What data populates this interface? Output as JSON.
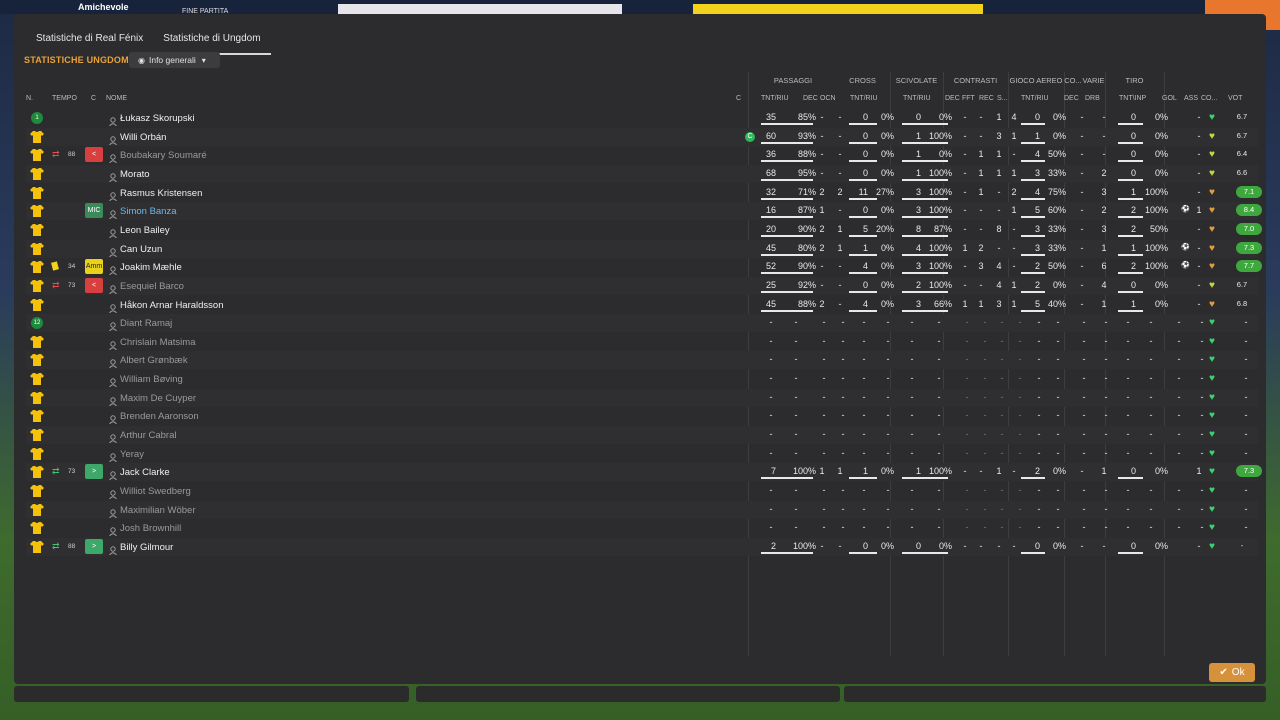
{
  "background": {
    "comp": "Amichevole",
    "status": "FINE PARTITA"
  },
  "tabs": [
    "Statistiche di Real Fénix",
    "Statistiche di Ungdom"
  ],
  "section_title": "STATISTICHE UNGDOM",
  "dropdown": "Info generali",
  "groups": [
    "PASSAGGI",
    "CROSS",
    "SCIVOLATE",
    "CONTRASTI",
    "GIOCO AEREO",
    "CO...",
    "VARIE",
    "TIRO"
  ],
  "headers": {
    "n": "N.",
    "time": "TEMPO",
    "c": "C",
    "name": "NOME",
    "capt": "C",
    "pas": "TNT/RIU",
    "dec": "DEC",
    "ocn": "OCN",
    "cross": "TNT/RIU",
    "sciv": "TNT/RIU",
    "cdec": "DEC",
    "fft": "FFT",
    "rec": "REC",
    "s": "S...",
    "air": "TNT/RIU",
    "codec": "DEC",
    "drb": "DRB",
    "tiro": "TNT\\INP",
    "gol": "GOL",
    "ass": "ASS",
    "co": "CO...",
    "vot": "VOT"
  },
  "players": [
    {
      "name": "Łukasz Skorupski",
      "kit": "gk",
      "num": "1",
      "pas": [
        "35",
        "85%"
      ],
      "d": "-",
      "o": "-",
      "cr": [
        "0",
        "0%"
      ],
      "sc": [
        "0",
        "0%"
      ],
      "cd": "-",
      "ff": "-",
      "re": "1",
      "s": "4",
      "ai": [
        "0",
        "0%"
      ],
      "co": "-",
      "dr": "-",
      "ti": [
        "0",
        "0%"
      ],
      "gl": "",
      "as": "-",
      "hc": "#39d46b",
      "vo": "6.7",
      "vb": ""
    },
    {
      "name": "Willi Orbán",
      "kit": "y",
      "capt": "C",
      "pas": [
        "60",
        "93%"
      ],
      "d": "-",
      "o": "-",
      "cr": [
        "0",
        "0%"
      ],
      "sc": [
        "1",
        "100%"
      ],
      "cd": "-",
      "ff": "-",
      "re": "3",
      "s": "1",
      "ai": [
        "1",
        "0%"
      ],
      "co": "-",
      "dr": "-",
      "ti": [
        "0",
        "0%"
      ],
      "gl": "",
      "as": "-",
      "hc": "#c8d640",
      "vo": "6.7",
      "vb": ""
    },
    {
      "name": "Boubakary Soumaré",
      "kit": "y",
      "dim": true,
      "sub": "off",
      "min": "88",
      "role": "<",
      "rolebg": "#d84040",
      "pas": [
        "36",
        "88%"
      ],
      "d": "-",
      "o": "-",
      "cr": [
        "0",
        "0%"
      ],
      "sc": [
        "1",
        "0%"
      ],
      "cd": "-",
      "ff": "1",
      "re": "1",
      "s": "-",
      "ai": [
        "4",
        "50%"
      ],
      "co": "-",
      "dr": "-",
      "ti": [
        "0",
        "0%"
      ],
      "gl": "",
      "as": "-",
      "hc": "#c8d640",
      "vo": "6.4",
      "vb": ""
    },
    {
      "name": "Morato",
      "kit": "y",
      "pas": [
        "68",
        "95%"
      ],
      "d": "-",
      "o": "-",
      "cr": [
        "0",
        "0%"
      ],
      "sc": [
        "1",
        "100%"
      ],
      "cd": "-",
      "ff": "1",
      "re": "1",
      "s": "1",
      "ai": [
        "3",
        "33%"
      ],
      "co": "-",
      "dr": "2",
      "ti": [
        "0",
        "0%"
      ],
      "gl": "",
      "as": "-",
      "hc": "#c8d640",
      "vo": "6.6",
      "vb": ""
    },
    {
      "name": "Rasmus Kristensen",
      "kit": "y",
      "pas": [
        "32",
        "71%"
      ],
      "d": "2",
      "o": "2",
      "cr": [
        "11",
        "27%"
      ],
      "sc": [
        "3",
        "100%"
      ],
      "cd": "-",
      "ff": "1",
      "re": "-",
      "s": "2",
      "ai": [
        "4",
        "75%"
      ],
      "co": "-",
      "dr": "3",
      "ti": [
        "1",
        "100%"
      ],
      "gl": "",
      "as": "-",
      "hc": "#e0a040",
      "vo": "7.1",
      "vb": "#3ea83e"
    },
    {
      "name": "Simon Banza",
      "kit": "y",
      "blue": true,
      "role": "MIC",
      "rolebg": "#3a8a5a",
      "pas": [
        "16",
        "87%"
      ],
      "d": "1",
      "o": "-",
      "cr": [
        "0",
        "0%"
      ],
      "sc": [
        "3",
        "100%"
      ],
      "cd": "-",
      "ff": "-",
      "re": "-",
      "s": "1",
      "ai": [
        "5",
        "60%"
      ],
      "co": "-",
      "dr": "2",
      "ti": [
        "2",
        "100%"
      ],
      "gl": "⚽",
      "as": "1",
      "hc": "#e0a040",
      "vo": "8.4",
      "vb": "#3ea83e"
    },
    {
      "name": "Leon Bailey",
      "kit": "y",
      "pas": [
        "20",
        "90%"
      ],
      "d": "2",
      "o": "1",
      "cr": [
        "5",
        "20%"
      ],
      "sc": [
        "8",
        "87%"
      ],
      "cd": "-",
      "ff": "-",
      "re": "8",
      "s": "-",
      "ai": [
        "3",
        "33%"
      ],
      "co": "-",
      "dr": "3",
      "ti": [
        "2",
        "50%"
      ],
      "gl": "",
      "as": "-",
      "hc": "#e0a040",
      "vo": "7.0",
      "vb": "#3ea83e"
    },
    {
      "name": "Can Uzun",
      "kit": "y",
      "pas": [
        "45",
        "80%"
      ],
      "d": "2",
      "o": "1",
      "cr": [
        "1",
        "0%"
      ],
      "sc": [
        "4",
        "100%"
      ],
      "cd": "1",
      "ff": "2",
      "re": "-",
      "s": "-",
      "ai": [
        "3",
        "33%"
      ],
      "co": "-",
      "dr": "1",
      "ti": [
        "1",
        "100%"
      ],
      "gl": "⚽",
      "as": "-",
      "hc": "#e0a040",
      "vo": "7.3",
      "vb": "#3ea83e"
    },
    {
      "name": "Joakim Mæhle",
      "kit": "y",
      "card": true,
      "min": "34",
      "role": "Amm",
      "rolebg": "#e8d21a",
      "pas": [
        "52",
        "90%"
      ],
      "d": "-",
      "o": "-",
      "cr": [
        "4",
        "0%"
      ],
      "sc": [
        "3",
        "100%"
      ],
      "cd": "-",
      "ff": "3",
      "re": "4",
      "s": "-",
      "ai": [
        "2",
        "50%"
      ],
      "co": "-",
      "dr": "6",
      "ti": [
        "2",
        "100%"
      ],
      "gl": "⚽",
      "as": "-",
      "hc": "#e0a040",
      "vo": "7.7",
      "vb": "#3ea83e"
    },
    {
      "name": "Esequiel Barco",
      "kit": "y",
      "dim": true,
      "sub": "off",
      "min": "73",
      "role": "<",
      "rolebg": "#d84040",
      "pas": [
        "25",
        "92%"
      ],
      "d": "-",
      "o": "-",
      "cr": [
        "0",
        "0%"
      ],
      "sc": [
        "2",
        "100%"
      ],
      "cd": "-",
      "ff": "-",
      "re": "4",
      "s": "1",
      "ai": [
        "2",
        "0%"
      ],
      "co": "-",
      "dr": "4",
      "ti": [
        "0",
        "0%"
      ],
      "gl": "",
      "as": "-",
      "hc": "#c8d640",
      "vo": "6.7",
      "vb": ""
    },
    {
      "name": "Håkon Arnar Haraldsson",
      "kit": "y",
      "pas": [
        "45",
        "88%"
      ],
      "d": "2",
      "o": "-",
      "cr": [
        "4",
        "0%"
      ],
      "sc": [
        "3",
        "66%"
      ],
      "cd": "1",
      "ff": "1",
      "re": "3",
      "s": "1",
      "ai": [
        "5",
        "40%"
      ],
      "co": "-",
      "dr": "1",
      "ti": [
        "1",
        "0%"
      ],
      "gl": "",
      "as": "-",
      "hc": "#e0a040",
      "vo": "6.8",
      "vb": ""
    },
    {
      "name": "Diant Ramaj",
      "kit": "gk",
      "num": "12",
      "dim": true,
      "empty": true,
      "hc": "#39d46b"
    },
    {
      "name": "Chrislain Matsima",
      "kit": "y",
      "dim": true,
      "empty": true,
      "hc": "#39d46b"
    },
    {
      "name": "Albert Grønbæk",
      "kit": "y",
      "dim": true,
      "empty": true,
      "hc": "#39d46b"
    },
    {
      "name": "William Bøving",
      "kit": "y",
      "dim": true,
      "empty": true,
      "hc": "#39d46b"
    },
    {
      "name": "Maxim De Cuyper",
      "kit": "y",
      "dim": true,
      "empty": true,
      "hc": "#39d46b"
    },
    {
      "name": "Brenden Aaronson",
      "kit": "y",
      "dim": true,
      "empty": true,
      "hc": "#39d46b"
    },
    {
      "name": "Arthur Cabral",
      "kit": "y",
      "dim": true,
      "empty": true,
      "hc": "#39d46b"
    },
    {
      "name": "Yeray",
      "kit": "y",
      "dim": true,
      "empty": true,
      "hc": "#39d46b"
    },
    {
      "name": "Jack Clarke",
      "kit": "y",
      "sub": "on",
      "min": "73",
      "role": ">",
      "rolebg": "#3ea86a",
      "pas": [
        "7",
        "100%"
      ],
      "d": "1",
      "o": "1",
      "cr": [
        "1",
        "0%"
      ],
      "sc": [
        "1",
        "100%"
      ],
      "cd": "-",
      "ff": "-",
      "re": "1",
      "s": "-",
      "ai": [
        "2",
        "0%"
      ],
      "co": "-",
      "dr": "1",
      "ti": [
        "0",
        "0%"
      ],
      "gl": "",
      "as": "1",
      "hc": "#39d46b",
      "vo": "7.3",
      "vb": "#3ea83e"
    },
    {
      "name": "Williot Swedberg",
      "kit": "y",
      "dim": true,
      "empty": true,
      "hc": "#39d46b"
    },
    {
      "name": "Maximilian Wöber",
      "kit": "y",
      "dim": true,
      "empty": true,
      "hc": "#39d46b"
    },
    {
      "name": "Josh Brownhill",
      "kit": "y",
      "dim": true,
      "empty": true,
      "hc": "#39d46b"
    },
    {
      "name": "Billy Gilmour",
      "kit": "y",
      "sub": "on",
      "min": "88",
      "role": ">",
      "rolebg": "#3ea86a",
      "pas": [
        "2",
        "100%"
      ],
      "d": "-",
      "o": "-",
      "cr": [
        "0",
        "0%"
      ],
      "sc": [
        "0",
        "0%"
      ],
      "cd": "-",
      "ff": "-",
      "re": "-",
      "s": "-",
      "ai": [
        "0",
        "0%"
      ],
      "co": "-",
      "dr": "-",
      "ti": [
        "0",
        "0%"
      ],
      "gl": "",
      "as": "-",
      "hc": "#39d46b",
      "vo": "-",
      "vb": ""
    }
  ],
  "ok_label": "Ok"
}
